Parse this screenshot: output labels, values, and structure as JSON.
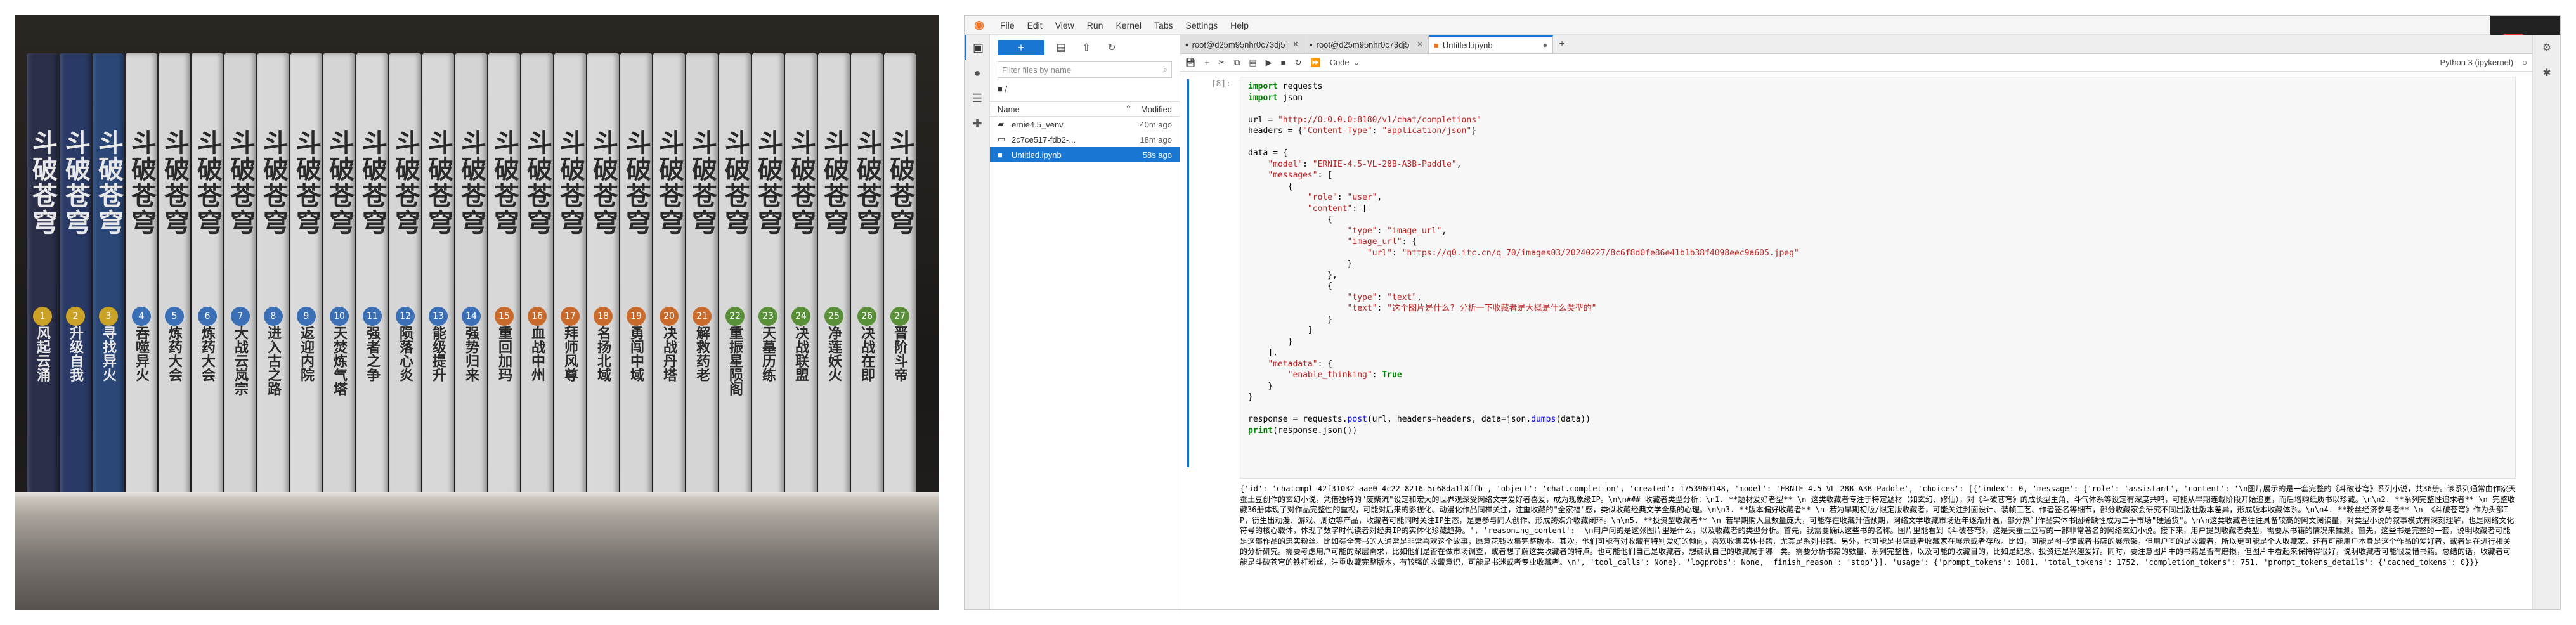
{
  "photo": {
    "books": [
      {
        "title": "斗破苍穹",
        "subtitle": "风起云涌",
        "num": "1",
        "color": "#2b2f4a",
        "tc": "#e8e8e8"
      },
      {
        "title": "斗破苍穹",
        "subtitle": "升级自我",
        "num": "2",
        "color": "#2a3a66",
        "tc": "#e8e8e8"
      },
      {
        "title": "斗破苍穹",
        "subtitle": "寻找异火",
        "num": "3",
        "color": "#2b4777",
        "tc": "#e8e8e8"
      },
      {
        "title": "斗破苍穹",
        "subtitle": "吞噬异火",
        "num": "4",
        "color": "#d8d8d8",
        "tc": "#2a2a2a"
      },
      {
        "title": "斗破苍穹",
        "subtitle": "炼药大会",
        "num": "5",
        "color": "#d6d6d6",
        "tc": "#2a2a2a"
      },
      {
        "title": "斗破苍穹",
        "subtitle": "炼药大会",
        "num": "6",
        "color": "#d9d9d9",
        "tc": "#2a2a2a"
      },
      {
        "title": "斗破苍穹",
        "subtitle": "大战云岚宗",
        "num": "7",
        "color": "#d4d4d4",
        "tc": "#2a2a2a"
      },
      {
        "title": "斗破苍穹",
        "subtitle": "进入古之路",
        "num": "8",
        "color": "#d8d8d8",
        "tc": "#2a2a2a"
      },
      {
        "title": "斗破苍穹",
        "subtitle": "返迎内院",
        "num": "9",
        "color": "#dadada",
        "tc": "#2a2a2a"
      },
      {
        "title": "斗破苍穹",
        "subtitle": "天焚炼气塔",
        "num": "10",
        "color": "#d5d5d5",
        "tc": "#2a2a2a"
      },
      {
        "title": "斗破苍穹",
        "subtitle": "强者之争",
        "num": "11",
        "color": "#d9d9d9",
        "tc": "#2a2a2a"
      },
      {
        "title": "斗破苍穹",
        "subtitle": "陨落心炎",
        "num": "12",
        "color": "#d6d6d6",
        "tc": "#2a2a2a"
      },
      {
        "title": "斗破苍穹",
        "subtitle": "能级提升",
        "num": "13",
        "color": "#d8d8d8",
        "tc": "#2a2a2a"
      },
      {
        "title": "斗破苍穹",
        "subtitle": "强势归来",
        "num": "14",
        "color": "#d4d4d4",
        "tc": "#2a2a2a"
      },
      {
        "title": "斗破苍穹",
        "subtitle": "重回加玛",
        "num": "15",
        "color": "#d7d7d7",
        "tc": "#2a2a2a"
      },
      {
        "title": "斗破苍穹",
        "subtitle": "血战中州",
        "num": "16",
        "color": "#d5d5d5",
        "tc": "#2a2a2a"
      },
      {
        "title": "斗破苍穹",
        "subtitle": "拜师风尊",
        "num": "17",
        "color": "#d8d8d8",
        "tc": "#2a2a2a"
      },
      {
        "title": "斗破苍穹",
        "subtitle": "名扬北域",
        "num": "18",
        "color": "#d9d9d9",
        "tc": "#2a2a2a"
      },
      {
        "title": "斗破苍穹",
        "subtitle": "勇闯中域",
        "num": "19",
        "color": "#d6d6d6",
        "tc": "#2a2a2a"
      },
      {
        "title": "斗破苍穹",
        "subtitle": "决战丹塔",
        "num": "20",
        "color": "#d8d8d8",
        "tc": "#2a2a2a"
      },
      {
        "title": "斗破苍穹",
        "subtitle": "解救药老",
        "num": "21",
        "color": "#d5d5d5",
        "tc": "#2a2a2a"
      },
      {
        "title": "斗破苍穹",
        "subtitle": "重振星陨阁",
        "num": "22",
        "color": "#d7d7d7",
        "tc": "#2a2a2a"
      },
      {
        "title": "斗破苍穹",
        "subtitle": "天墓历练",
        "num": "23",
        "color": "#d9d9d9",
        "tc": "#2a2a2a"
      },
      {
        "title": "斗破苍穹",
        "subtitle": "决战联盟",
        "num": "24",
        "color": "#d6d6d6",
        "tc": "#2a2a2a"
      },
      {
        "title": "斗破苍穹",
        "subtitle": "净莲妖火",
        "num": "25",
        "color": "#d8d8d8",
        "tc": "#2a2a2a"
      },
      {
        "title": "斗破苍穹",
        "subtitle": "决战在即",
        "num": "26",
        "color": "#d5d5d5",
        "tc": "#2a2a2a"
      },
      {
        "title": "斗破苍穹",
        "subtitle": "晋阶斗帝",
        "num": "27",
        "color": "#d9d9d9",
        "tc": "#2a2a2a"
      }
    ]
  },
  "menubar": {
    "items": [
      "File",
      "Edit",
      "View",
      "Run",
      "Kernel",
      "Tabs",
      "Settings",
      "Help"
    ]
  },
  "topright": {
    "badge": "连接"
  },
  "filebrowser": {
    "filter_placeholder": "Filter files by name",
    "path": "■ /",
    "col_name": "Name",
    "col_modified": "Modified",
    "files": [
      {
        "icon": "folder-icon",
        "name": "ernie4.5_venv",
        "modified": "40m ago",
        "selected": false
      },
      {
        "icon": "file-icon",
        "name": "2c7ce517-fdb2-...",
        "modified": "18m ago",
        "selected": false
      },
      {
        "icon": "notebook-icon",
        "name": "Untitled.ipynb",
        "modified": "58s ago",
        "selected": true
      }
    ]
  },
  "tabs": [
    {
      "label": "root@d25m95nhr0c73dj5",
      "active": false
    },
    {
      "label": "root@d25m95nhr0c73dj5",
      "active": false
    },
    {
      "label": "Untitled.ipynb",
      "active": true
    }
  ],
  "toolbar": {
    "cell_type": "Code",
    "kernel": "Python 3 (ipykernel)"
  },
  "cell": {
    "prompt": "[8]:",
    "code_lines": [
      "import requests",
      "import json",
      "",
      "url = \"http://0.0.0.0:8180/v1/chat/completions\"",
      "headers = {\"Content-Type\": \"application/json\"}",
      "",
      "data = {",
      "    \"model\": \"ERNIE-4.5-VL-28B-A3B-Paddle\",",
      "    \"messages\": [",
      "        {",
      "            \"role\": \"user\",",
      "            \"content\": [",
      "                {",
      "                    \"type\": \"image_url\",",
      "                    \"image_url\": {",
      "                        \"url\": \"https://q0.itc.cn/q_70/images03/20240227/8c6f8d0fe86e41b1b38f4098eec9a605.jpeg\"",
      "                    }",
      "                },",
      "                {",
      "                    \"type\": \"text\",",
      "                    \"text\": \"这个图片是什么? 分析一下收藏者是大概是什么类型的\"",
      "                }",
      "            ]",
      "        }",
      "    ],",
      "    \"metadata\": {",
      "        \"enable_thinking\": True",
      "    }",
      "}",
      "",
      "response = requests.post(url, headers=headers, data=json.dumps(data))",
      "print(response.json())"
    ],
    "output": "{'id': 'chatcmpl-42f31032-aae0-4c22-8216-5c68da1l8ffb', 'object': 'chat.completion', 'created': 1753969148, 'model': 'ERNIE-4.5-VL-28B-A3B-Paddle', 'choices': [{'index': 0, 'message': {'role': 'assistant', 'content': '\\n图片展示的是一套完整的《斗破苍穹》系列小说，共36册。该系列通常由作家天蚕土豆创作的玄幻小说，凭借独特的\"废柴流\"设定和宏大的世界观深受网络文学爱好者喜爱，成为现象级IP。\\n\\n### 收藏者类型分析：\\n1. **题材爱好者型**  \\n   这类收藏者专注于特定题材（如玄幻、修仙），对《斗破苍穹》的成长型主角、斗气体系等设定有深度共鸣，可能从早期连载阶段开始追更，而后增购纸质书以珍藏。\\n\\n2. **系列完整性追求者**  \\n   完整收藏36册体现了对作品完整性的重视，可能对后来的影视化、动漫化作品同样关注，注重收藏的\"全家福\"感，类似收藏经典文学全集的心理。\\n\\n3. **版本偏好收藏者**  \\n   若为早期初版/限定版收藏者，可能关注封面设计、装帧工艺、作者签名等细节，部分收藏家会研究不同出版社版本差异，形成版本收藏体系。\\n\\n4. **粉丝经济参与者**  \\n   《斗破苍穹》作为头部IP，衍生出动漫、游戏、周边等产品，收藏者可能同时关注IP生态，是更参与同人创作、形成跨媒介收藏闭环。\\n\\n5. **投资型收藏者**  \\n   若早期购入且数量庞大，可能存在收藏升值预期，网络文学收藏市场近年逐渐升温，部分热门作品实体书因稀缺性成为二手市场\"硬通货\"。\\n\\n这类收藏者往往具备较高的网文阅读量，对类型小说的叙事模式有深刻理解，也是网络文化符号的核心载体，体现了数字时代读者对经典IP的实体化珍藏趋势。', 'reasoning_content': '\\n用户问的是这张图片里是什么，以及收藏者的类型分析。首先，我需要确认这些书的名称。图片里能看到《斗破苍穹》，这是天蚕土豆写的一部非常著名的网络玄幻小说。接下来，用户提到收藏者类型，需要从书籍的情况来推测。首先，这些书是完整的一套，说明收藏者可能是这部作品的忠实粉丝。比如买全套书的人通常是非常喜欢这个故事，愿意花钱收集完整版本。其次，他们可能有对收藏有特别爱好的倾向，喜欢收集实体书籍，尤其是系列书籍。另外，也可能是书店或者收藏家在展示或者存放。比如，可能是图书馆或者书店的展示架，但用户问的是收藏者，所以更可能是个人收藏家。还有可能用户本身是这个作品的爱好者，或者是在进行相关的分析研究。需要考虑用户可能的深层需求，比如他们是否在做市场调查，或者想了解这类收藏者的特点。也可能他们自己是收藏者，想确认自己的收藏属于哪一类。需要分析书籍的数量、系列完整性，以及可能的收藏目的，比如是纪念、投资还是兴趣爱好。同时，要注意图片中的书籍是否有磨损，但图片中看起来保持得很好，说明收藏者可能很爱惜书籍。总结的话，收藏者可能是斗破苍穹的铁杆粉丝，注重收藏完整版本，有较强的收藏意识，可能是书迷或者专业收藏者。\\n', 'tool_calls': None}, 'logprobs': None, 'finish_reason': 'stop'}], 'usage': {'prompt_tokens': 1001, 'total_tokens': 1752, 'completion_tokens': 751, 'prompt_tokens_details': {'cached_tokens': 0}}}"
  }
}
